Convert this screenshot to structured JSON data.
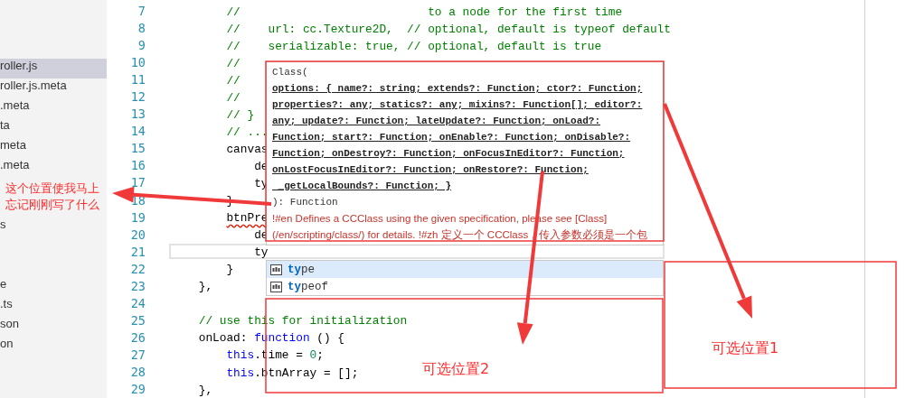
{
  "sidebar": {
    "groups": [
      {
        "items": [
          {
            "label": "roller.js",
            "selected": true
          },
          {
            "label": "roller.js.meta",
            "selected": false
          },
          {
            "label": ".meta",
            "selected": false
          },
          {
            "label": "ta",
            "selected": false
          },
          {
            "label": "meta",
            "selected": false
          },
          {
            "label": ".meta",
            "selected": false
          }
        ]
      },
      {
        "items": [
          {
            "label": "s",
            "selected": false
          }
        ]
      },
      {
        "items": [
          {
            "label": "e",
            "selected": false
          },
          {
            "label": ".ts",
            "selected": false
          },
          {
            "label": "son",
            "selected": false
          },
          {
            "label": "on",
            "selected": false
          }
        ]
      }
    ]
  },
  "editor": {
    "lines": [
      {
        "number": "7",
        "tokens": [
          {
            "text": "        //                           to a node for the first time",
            "kind": "comment"
          }
        ]
      },
      {
        "number": "8",
        "tokens": [
          {
            "text": "        //    url: cc.Texture2D,  // optional, default is typeof default",
            "kind": "comment"
          }
        ]
      },
      {
        "number": "9",
        "tokens": [
          {
            "text": "        //    serializable: true, // optional, default is true",
            "kind": "comment"
          }
        ]
      },
      {
        "number": "10",
        "tokens": [
          {
            "text": "        //",
            "kind": "comment"
          }
        ]
      },
      {
        "number": "11",
        "tokens": [
          {
            "text": "        //",
            "kind": "comment"
          }
        ]
      },
      {
        "number": "12",
        "tokens": [
          {
            "text": "        //",
            "kind": "comment"
          }
        ]
      },
      {
        "number": "13",
        "tokens": [
          {
            "text": "        // }",
            "kind": "comment"
          }
        ]
      },
      {
        "number": "14",
        "tokens": [
          {
            "text": "        // ...",
            "kind": "comment"
          }
        ]
      },
      {
        "number": "15",
        "tokens": [
          {
            "text": "        canvas",
            "kind": "plain"
          }
        ]
      },
      {
        "number": "16",
        "tokens": [
          {
            "text": "            de",
            "kind": "plain"
          }
        ]
      },
      {
        "number": "17",
        "tokens": [
          {
            "text": "            ty",
            "kind": "plain"
          }
        ]
      },
      {
        "number": "18",
        "tokens": [
          {
            "text": "        }",
            "kind": "plain"
          }
        ]
      },
      {
        "number": "19",
        "tokens": [
          {
            "text": "        btnPre",
            "kind": "plain",
            "error": true
          }
        ]
      },
      {
        "number": "20",
        "tokens": [
          {
            "text": "            de",
            "kind": "plain"
          }
        ]
      },
      {
        "number": "21",
        "current": true,
        "tokens": [
          {
            "text": "            ty",
            "kind": "plain"
          }
        ]
      },
      {
        "number": "22",
        "tokens": [
          {
            "text": "        }",
            "kind": "plain"
          }
        ]
      },
      {
        "number": "23",
        "tokens": [
          {
            "text": "    },",
            "kind": "plain"
          }
        ]
      },
      {
        "number": "24"
      },
      {
        "number": "25",
        "tokens": [
          {
            "text": "    // use this for initialization",
            "kind": "comment"
          }
        ]
      },
      {
        "number": "26",
        "tokens": [
          {
            "text": "    onLoad: ",
            "kind": "plain"
          },
          {
            "text": "function",
            "kind": "keyword"
          },
          {
            "text": " () {",
            "kind": "plain"
          }
        ]
      },
      {
        "number": "27",
        "tokens": [
          {
            "text": "        this",
            "kind": "keyword"
          },
          {
            "text": ".time = ",
            "kind": "plain"
          },
          {
            "text": "0",
            "kind": "number"
          },
          {
            "text": ";",
            "kind": "plain"
          }
        ]
      },
      {
        "number": "28",
        "tokens": [
          {
            "text": "        this",
            "kind": "keyword"
          },
          {
            "text": ".btnArray = [];",
            "kind": "plain"
          }
        ]
      },
      {
        "number": "29",
        "tokens": [
          {
            "text": "    },",
            "kind": "plain"
          }
        ]
      }
    ],
    "hover": {
      "signature_open": "Class(",
      "params": [
        "options: { name?: string; extends?: Function; ctor?: Function;",
        "properties?: any; statics?: any; mixins?: Function[]; editor?:",
        "any; update?: Function; lateUpdate?: Function; onLoad?:",
        "Function; start?: Function; onEnable?: Function; onDisable?:",
        "Function; onDestroy?: Function; onFocusInEditor?: Function;",
        "onLostFocusInEditor?: Function; onRestore?: Function;",
        " _getLocalBounds?: Function; }"
      ],
      "signature_close": "): Function",
      "doc": "!#en Defines a CCClass using the given specification, please see [Class] (/en/scripting/class/) for details. !#zh 定义一个 CCClass，传入参数必须是一个包"
    },
    "suggestions": [
      {
        "match": "ty",
        "rest": "pe",
        "selected": true
      },
      {
        "match": "ty",
        "rest": "peof",
        "selected": false
      }
    ]
  },
  "annotations": {
    "callout": "这个位置使我马上忘记刚刚写了什么",
    "labels": [
      "可选位置1",
      "可选位置2"
    ]
  }
}
